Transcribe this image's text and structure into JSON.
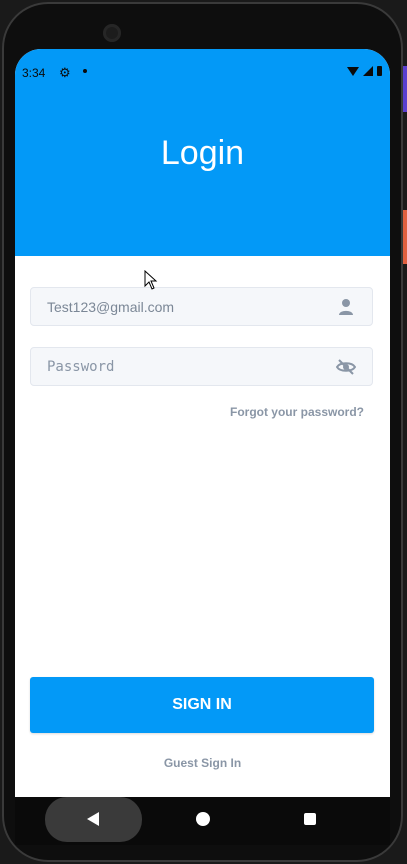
{
  "status_bar": {
    "time": "3:34"
  },
  "header": {
    "title": "Login"
  },
  "form": {
    "email_value": "Test123@gmail.com",
    "password_placeholder": "Password",
    "forgot_label": "Forgot your password?"
  },
  "actions": {
    "signin_label": "SIGN IN",
    "guest_label": "Guest Sign In"
  },
  "icons": {
    "email_field_icon": "person-icon",
    "password_field_icon": "visibility-off-icon"
  },
  "colors": {
    "accent": "#0399f7",
    "field_bg": "#f5f7fa",
    "muted_text": "#8a96a6"
  }
}
